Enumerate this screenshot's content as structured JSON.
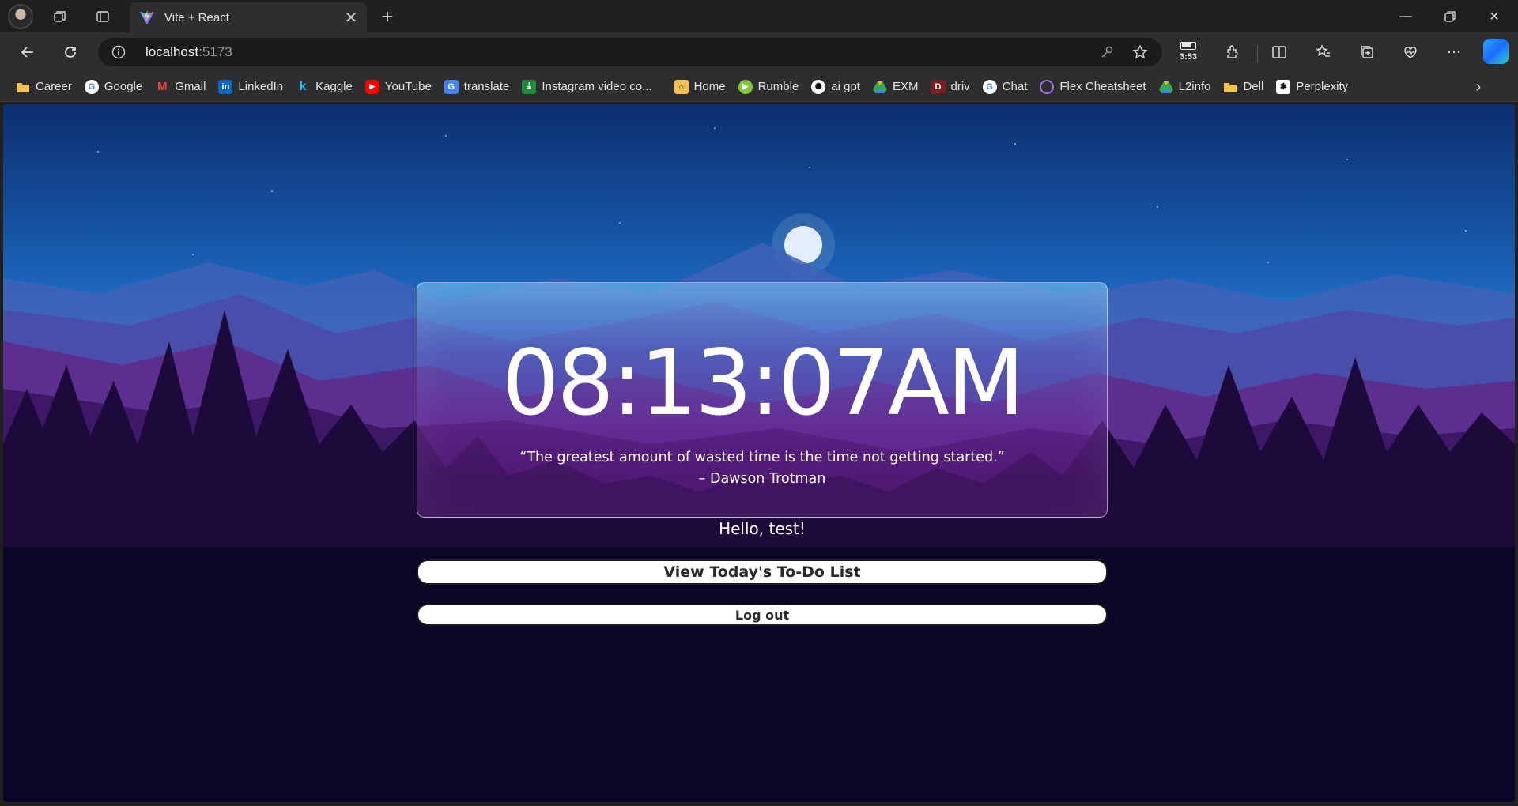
{
  "browser": {
    "tab_title": "Vite + React",
    "url_host": "localhost",
    "url_port": ":5173",
    "battery_time": "3:53"
  },
  "bookmarks": [
    {
      "label": "Career",
      "icon": "folder-icon",
      "color": "#f2c24f"
    },
    {
      "label": "Google",
      "icon": "google-icon",
      "color": "#ffffff"
    },
    {
      "label": "Gmail",
      "icon": "gmail-icon",
      "color": "#ea4335"
    },
    {
      "label": "LinkedIn",
      "icon": "linkedin-icon",
      "color": "#0a66c2"
    },
    {
      "label": "Kaggle",
      "icon": "kaggle-icon",
      "color": "#20beff"
    },
    {
      "label": "YouTube",
      "icon": "youtube-icon",
      "color": "#ff0000"
    },
    {
      "label": "translate",
      "icon": "translate-icon",
      "color": "#4285f4"
    },
    {
      "label": "Instagram video co...",
      "icon": "instagram-video-icon",
      "color": "#1e8a3a"
    },
    {
      "label": "Home",
      "icon": "home-icon",
      "color": "#f2c24f"
    },
    {
      "label": "Rumble",
      "icon": "rumble-icon",
      "color": "#85c742"
    },
    {
      "label": "ai gpt",
      "icon": "chatgpt-icon",
      "color": "#ffffff"
    },
    {
      "label": "EXM",
      "icon": "drive-icon",
      "color": "#34a853"
    },
    {
      "label": "driv",
      "icon": "driv-icon",
      "color": "#c0392b"
    },
    {
      "label": "Chat",
      "icon": "google-icon",
      "color": "#ffffff"
    },
    {
      "label": "Flex Cheatsheet",
      "icon": "flex-icon",
      "color": "#a86cf0"
    },
    {
      "label": "L2info",
      "icon": "drive-icon",
      "color": "#34a853"
    },
    {
      "label": "Dell",
      "icon": "folder-icon",
      "color": "#f2c24f"
    },
    {
      "label": "Perplexity",
      "icon": "perplexity-icon",
      "color": "#ffffff"
    }
  ],
  "page": {
    "clock": "08:13:07AM",
    "quote_line1": "“The greatest amount of wasted time is the time not getting started.”",
    "quote_line2": "– Dawson Trotman",
    "greeting": "Hello, test!",
    "todo_button": "View Today's To-Do List",
    "logout_button": "Log out"
  }
}
